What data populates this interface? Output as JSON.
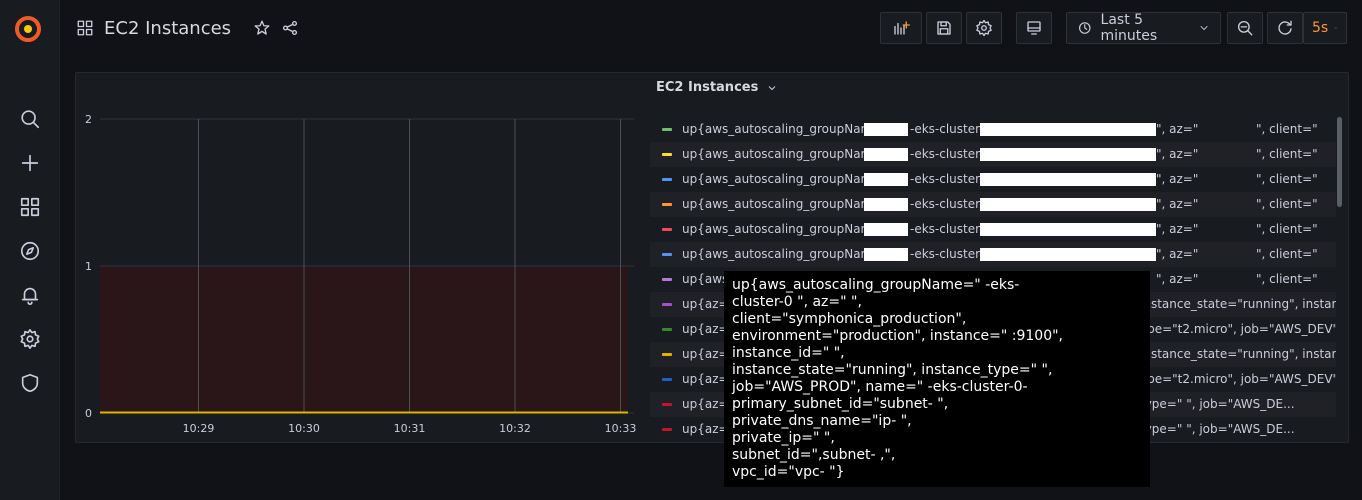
{
  "app": {
    "title": "EC2 Instances",
    "time_range": "Last 5 minutes",
    "refresh_interval": "5s"
  },
  "sidebar": {
    "items": [
      {
        "icon": "search-icon"
      },
      {
        "icon": "plus-icon"
      },
      {
        "icon": "dashboards-icon"
      },
      {
        "icon": "explore-compass-icon"
      },
      {
        "icon": "alerting-bell-icon"
      },
      {
        "icon": "configuration-gear-icon"
      },
      {
        "icon": "server-admin-shield-icon"
      }
    ]
  },
  "panel": {
    "title": "EC2 Instances",
    "legend": [
      {
        "color": "#73bf69",
        "prefix": "up{aws_autoscaling_groupName=\"",
        "mid": "-eks-cluster-0",
        "az": "\", az=\"",
        "tail": "\", client=\""
      },
      {
        "color": "#fade2a",
        "prefix": "up{aws_autoscaling_groupName=\"",
        "mid": "-eks-cluster-0",
        "az": "\", az=\"",
        "tail": "\", client=\""
      },
      {
        "color": "#5794f2",
        "prefix": "up{aws_autoscaling_groupName=\"",
        "mid": "-eks-cluster-0",
        "az": "\", az=\"",
        "tail": "\", client=\""
      },
      {
        "color": "#ff9830",
        "prefix": "up{aws_autoscaling_groupName=\"",
        "mid": "-eks-cluster-0",
        "az": "\", az=\"",
        "tail": "\", client=\""
      },
      {
        "color": "#f2495c",
        "prefix": "up{aws_autoscaling_groupName=\"",
        "mid": "-eks-cluster-0",
        "az": "\", az=\"",
        "tail": "\", client=\""
      },
      {
        "color": "#5794f2",
        "prefix": "up{aws_autoscaling_groupName=\"",
        "mid": "-eks-cluster-0",
        "az": "\", az=\"",
        "tail": "\", client=\""
      },
      {
        "color": "#b877d9",
        "prefix": "up{aws_",
        "mid": "",
        "az": "\", az=\"",
        "tail": "\", client=\""
      },
      {
        "color": "#a352cc",
        "prefix": "up{az=\"",
        "mid": "",
        "az": "",
        "tail": "instance_state=\"running\", instanc..."
      },
      {
        "color": "#37872d",
        "prefix": "up{az=\"",
        "mid": "",
        "az": "",
        "tail": "ype=\"t2.micro\", job=\"AWS_DEV\", n..."
      },
      {
        "color": "#e0b400",
        "prefix": "up{az=\"",
        "mid": "",
        "az": "",
        "tail": "instance_state=\"running\", instanc..."
      },
      {
        "color": "#1f60c4",
        "prefix": "up{az=\"",
        "mid": "",
        "az": "",
        "tail": "ype=\"t2.micro\", job=\"AWS_DEV\", n..."
      },
      {
        "color": "#c4162a",
        "prefix": "up{az=\"",
        "mid": "",
        "az": "",
        "tail": "type=\"",
        "tail2": "\", job=\"AWS_DE..."
      },
      {
        "color": "#c4162a",
        "prefix": "up{az=\"",
        "mid": "",
        "az": "",
        "tail": "type=\"",
        "tail2": "\", job=\"AWS_DE..."
      }
    ]
  },
  "tooltip": {
    "lines": [
      "up{aws_autoscaling_groupName=\"          -eks-",
      "cluster-0                              \", az=\"           \",",
      "client=\"symphonica_production\",",
      "environment=\"production\", instance=\"               :9100\",",
      "instance_id=\"                        \",",
      "instance_state=\"running\", instance_type=\"            \",",
      "job=\"AWS_PROD\", name=\"                -eks-cluster-0-",
      "primary_subnet_id=\"subnet-                            \",",
      "private_dns_name=\"ip-                                   \",",
      "private_ip=\"              \",",
      "subnet_id=\",subnet-                          ,\",",
      "vpc_id=\"vpc-                       \"}"
    ]
  },
  "chart_data": {
    "type": "line",
    "x": [
      "10:29",
      "10:30",
      "10:31",
      "10:32",
      "10:33"
    ],
    "ylim": [
      0,
      2
    ],
    "yticks": [
      "0",
      "1",
      "2"
    ],
    "threshold": {
      "value": 1,
      "color": "#c4162a"
    },
    "series_color": "#e0b400",
    "values_constant": 0
  }
}
